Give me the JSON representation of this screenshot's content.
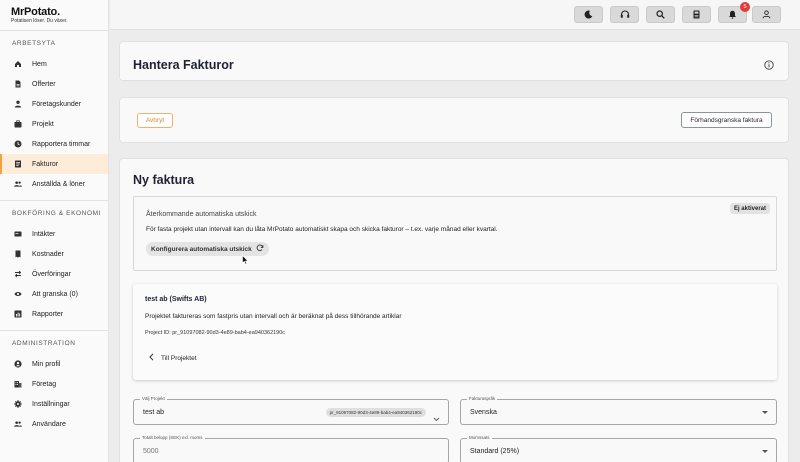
{
  "brand": {
    "name": "MrPotato.",
    "tagline": "Potatisen löser. Du växer."
  },
  "sidebar": {
    "sections": [
      {
        "title": "ARBETSYTA",
        "items": [
          {
            "label": "Hem",
            "icon": "home-icon"
          },
          {
            "label": "Offerter",
            "icon": "document-icon"
          },
          {
            "label": "Företagskunder",
            "icon": "person-icon"
          },
          {
            "label": "Projekt",
            "icon": "briefcase-icon"
          },
          {
            "label": "Rapportera timmar",
            "icon": "clock-icon"
          },
          {
            "label": "Fakturor",
            "icon": "invoice-icon",
            "active": true
          },
          {
            "label": "Anställda & löner",
            "icon": "people-icon"
          }
        ]
      },
      {
        "title": "BOKFÖRING & EKONOMI",
        "items": [
          {
            "label": "Intäkter",
            "icon": "income-icon"
          },
          {
            "label": "Kostnader",
            "icon": "receipt-icon"
          },
          {
            "label": "Överföringar",
            "icon": "transfer-icon"
          },
          {
            "label": "Att granska (0)",
            "icon": "eye-icon"
          },
          {
            "label": "Rapporter",
            "icon": "chart-icon"
          }
        ]
      },
      {
        "title": "ADMINISTRATION",
        "items": [
          {
            "label": "Min profil",
            "icon": "user-circle-icon"
          },
          {
            "label": "Företag",
            "icon": "building-icon"
          },
          {
            "label": "Inställningar",
            "icon": "gear-icon"
          },
          {
            "label": "Användare",
            "icon": "users-icon"
          }
        ]
      }
    ]
  },
  "topbar": {
    "notifications_count": "5"
  },
  "page": {
    "title": "Hantera Fakturor"
  },
  "actions": {
    "cancel": "Avbryt",
    "preview": "Förhandsgranska faktura"
  },
  "invoice": {
    "title": "Ny faktura",
    "auto": {
      "title": "Återkommande automatiska utskick",
      "description": "För fasta projekt utan intervall kan du låta MrPotato automatiskt skapa och skicka fakturor – t.ex. varje månad eller kvartal.",
      "configure": "Konfigurera automatiska utskick",
      "status": "Ej aktiverat"
    },
    "project": {
      "name": "test ab (Swifts AB)",
      "description": "Projektet faktureras som fastpris utan intervall och är beräknat på dess tillhörande artiklar",
      "id_text": "Project ID: pr_91097082-90d3-4e89-bab4-ea940362190c",
      "link": "Till Projektet"
    },
    "form": {
      "project_label": "Välj Projekt",
      "project_value": "test ab",
      "project_chip": "pr_91097082-90d3-4e89-bab4-ea940362190c",
      "language_label": "Fakturaspråk",
      "language_value": "Svenska",
      "amount_label": "Totalt belopp (SEK) exl. moms",
      "amount_value": "5000",
      "vat_label": "Momssats",
      "vat_value": "Standard (25%)"
    }
  },
  "colors": {
    "accent": "#f0a24a",
    "active_bg": "#fdecd7",
    "badge": "#e23b3b"
  }
}
